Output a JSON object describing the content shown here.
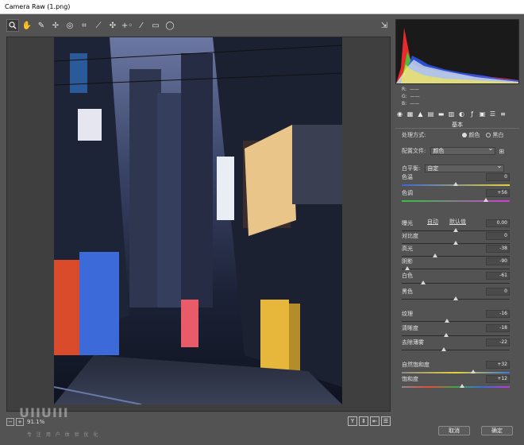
{
  "window": {
    "title": "Camera Raw (1.png)"
  },
  "toolbar": {
    "tools": [
      {
        "icon": "zoom-icon",
        "glyph": "🔍"
      },
      {
        "icon": "hand-icon",
        "glyph": "✋"
      },
      {
        "icon": "white-balance-icon",
        "glyph": "✎"
      },
      {
        "icon": "color-sampler-icon",
        "glyph": "✢"
      },
      {
        "icon": "target-adjust-icon",
        "glyph": "◎"
      },
      {
        "icon": "crop-icon",
        "glyph": "⌗"
      },
      {
        "icon": "straighten-icon",
        "glyph": "⟋"
      },
      {
        "icon": "spot-removal-icon",
        "glyph": "✣"
      },
      {
        "icon": "red-eye-icon",
        "glyph": "+◦"
      },
      {
        "icon": "adjustment-brush-icon",
        "glyph": "⁄"
      },
      {
        "icon": "graduated-filter-icon",
        "glyph": "▭"
      },
      {
        "icon": "radial-filter-icon",
        "glyph": "◯"
      }
    ],
    "export_icon": "⇲"
  },
  "status": {
    "zoom_minus": "−",
    "zoom_plus": "+",
    "zoom_value": "91.1%",
    "icons": [
      "Y",
      "⇕",
      "⇤",
      "☰"
    ]
  },
  "watermark": {
    "main": "UIIUIII",
    "sub": "专 注 用 户 体 验 优 化"
  },
  "histogram": {
    "rgb_r": "R:",
    "rgb_g": "G:",
    "rgb_b": "B:",
    "rgb_r_val": "——",
    "rgb_g_val": "——",
    "rgb_b_val": "——"
  },
  "panel": {
    "section_title": "基本",
    "process_label": "处理方式:",
    "process_color": "颜色",
    "process_bw": "黑白",
    "profile_label": "配置文件:",
    "profile_value": "颜色",
    "wb_label": "白平衡:",
    "wb_value": "自定",
    "auto_link": "自动",
    "default_link": "默认值"
  },
  "sliders": [
    {
      "name": "色温",
      "value": "0",
      "level": 0.5
    },
    {
      "name": "色调",
      "value": "+56",
      "level": 0.78
    },
    {
      "name": "曝光",
      "value": "0.00",
      "level": 0.5
    },
    {
      "name": "对比度",
      "value": "0",
      "level": 0.5
    },
    {
      "name": "高光",
      "value": "-38",
      "level": 0.31
    },
    {
      "name": "阴影",
      "value": "-90",
      "level": 0.05
    },
    {
      "name": "白色",
      "value": "-61",
      "level": 0.2
    },
    {
      "name": "黑色",
      "value": "0",
      "level": 0.5
    },
    {
      "name": "纹理",
      "value": "-16",
      "level": 0.42
    },
    {
      "name": "清晰度",
      "value": "-18",
      "level": 0.41
    },
    {
      "name": "去除薄雾",
      "value": "-22",
      "level": 0.39
    },
    {
      "name": "自然饱和度",
      "value": "+32",
      "level": 0.66
    },
    {
      "name": "饱和度",
      "value": "+12",
      "level": 0.56
    }
  ],
  "buttons": {
    "cancel": "取消",
    "ok": "确定"
  },
  "colors": {
    "panel_bg": "#535353",
    "accent_blue": "#4a7ad6",
    "histogram_bg": "#1a1a1a"
  }
}
